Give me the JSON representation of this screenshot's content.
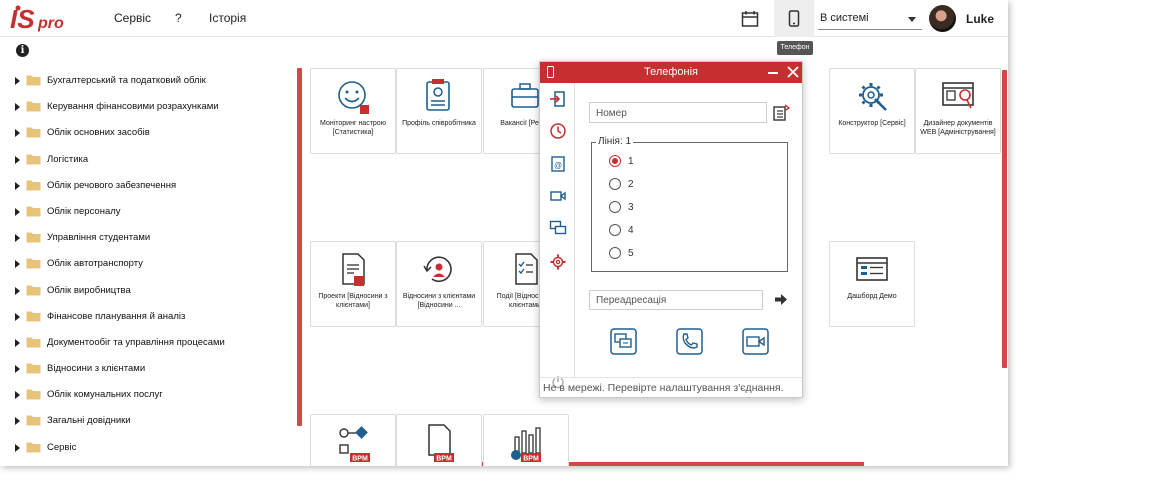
{
  "header": {
    "logo_text": "IS pro",
    "menu": [
      "Сервіс",
      "?",
      "Історія"
    ],
    "status_value": "В системі",
    "user_name": "Luke",
    "tooltip": "Телефон"
  },
  "sidebar": {
    "items": [
      "Бухгалтерський та податковий облік",
      "Керування фінансовими розрахунками",
      "Облік основних засобів",
      "Логістика",
      "Облік речового забезпечення",
      "Облік персоналу",
      "Управління студентами",
      "Облік автотранспорту",
      "Облік виробництва",
      "Фінансове планування й аналіз",
      "Документообіг та управління процесами",
      "Відносини з клієнтами",
      "Облік комунальних послуг",
      "Загальні довідники",
      "Сервіс"
    ]
  },
  "tiles": {
    "t1": "Моніторинг настрою [Статистика]",
    "t2": "Профіль співробітника",
    "t3": "Вакансії [Рекр...",
    "t4": "Конструктор [Сервіс]",
    "t5": "Дизайнер документів WEB [Адміністрування]",
    "t6": "Проекти [Відносини з клієнтами]",
    "t7": "Відносини з клієнтами [Відносини ...",
    "t8": "Події [Відносини з клієнтами]",
    "t9": "Дашборд Демо",
    "bpm_badge": "BPM"
  },
  "telephony": {
    "title": "Телефонія",
    "number_placeholder": "Номер",
    "line_legend": "Лінія: 1",
    "lines": [
      "1",
      "2",
      "3",
      "4",
      "5"
    ],
    "selected_line": "1",
    "forward_placeholder": "Переадресація",
    "status": "Не в мережі. Перевірте налаштування з'єднання."
  },
  "colors": {
    "accent": "#c62f2f",
    "bar": "#d14848",
    "icon_blue": "#1f5e8e",
    "folder": "#e8c47a"
  }
}
